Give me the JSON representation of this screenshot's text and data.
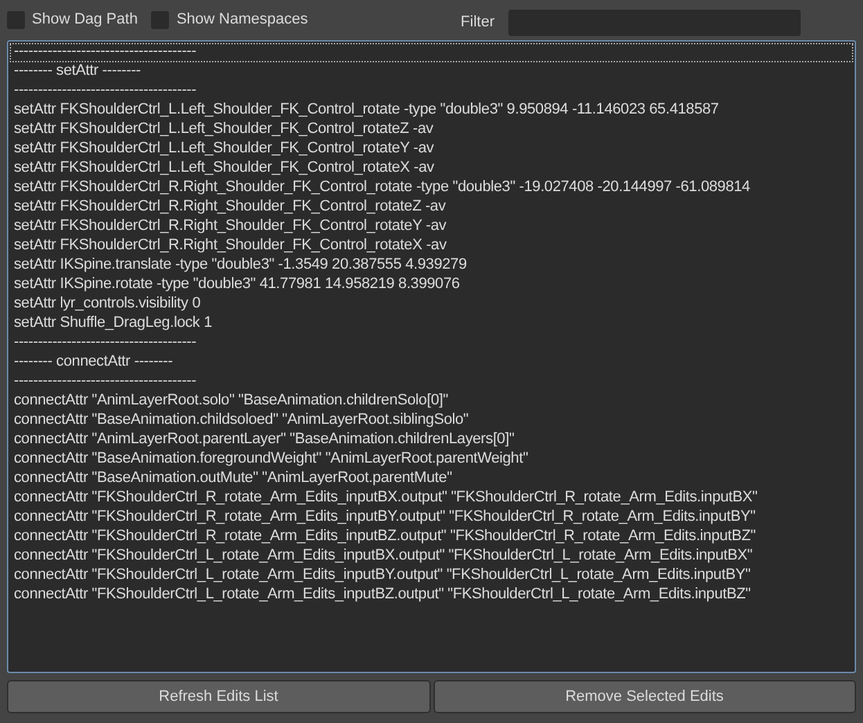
{
  "options": [
    {
      "label": "Show Dag Path",
      "checked": false
    },
    {
      "label": "Show Namespaces",
      "checked": false
    }
  ],
  "filter": {
    "label": "Filter"
  },
  "edits": [
    {
      "text": "--------------------------------------",
      "focused": true
    },
    {
      "text": "-------- setAttr --------",
      "focused": false
    },
    {
      "text": "--------------------------------------",
      "focused": false
    },
    {
      "text": "setAttr FKShoulderCtrl_L.Left_Shoulder_FK_Control_rotate -type \"double3\" 9.950894 -11.146023 65.418587",
      "focused": false
    },
    {
      "text": "setAttr FKShoulderCtrl_L.Left_Shoulder_FK_Control_rotateZ -av",
      "focused": false
    },
    {
      "text": "setAttr FKShoulderCtrl_L.Left_Shoulder_FK_Control_rotateY -av",
      "focused": false
    },
    {
      "text": "setAttr FKShoulderCtrl_L.Left_Shoulder_FK_Control_rotateX -av",
      "focused": false
    },
    {
      "text": "setAttr FKShoulderCtrl_R.Right_Shoulder_FK_Control_rotate -type \"double3\" -19.027408 -20.144997 -61.089814",
      "focused": false
    },
    {
      "text": "setAttr FKShoulderCtrl_R.Right_Shoulder_FK_Control_rotateZ -av",
      "focused": false
    },
    {
      "text": "setAttr FKShoulderCtrl_R.Right_Shoulder_FK_Control_rotateY -av",
      "focused": false
    },
    {
      "text": "setAttr FKShoulderCtrl_R.Right_Shoulder_FK_Control_rotateX -av",
      "focused": false
    },
    {
      "text": "setAttr IKSpine.translate -type \"double3\" -1.3549 20.387555 4.939279",
      "focused": false
    },
    {
      "text": "setAttr IKSpine.rotate -type \"double3\" 41.77981 14.958219 8.399076",
      "focused": false
    },
    {
      "text": "setAttr lyr_controls.visibility 0",
      "focused": false
    },
    {
      "text": "setAttr Shuffle_DragLeg.lock 1",
      "focused": false
    },
    {
      "text": "--------------------------------------",
      "focused": false
    },
    {
      "text": "-------- connectAttr --------",
      "focused": false
    },
    {
      "text": "--------------------------------------",
      "focused": false
    },
    {
      "text": "connectAttr \"AnimLayerRoot.solo\" \"BaseAnimation.childrenSolo[0]\"",
      "focused": false
    },
    {
      "text": "connectAttr \"BaseAnimation.childsoloed\" \"AnimLayerRoot.siblingSolo\"",
      "focused": false
    },
    {
      "text": "connectAttr \"AnimLayerRoot.parentLayer\" \"BaseAnimation.childrenLayers[0]\"",
      "focused": false
    },
    {
      "text": "connectAttr \"BaseAnimation.foregroundWeight\" \"AnimLayerRoot.parentWeight\"",
      "focused": false
    },
    {
      "text": "connectAttr \"BaseAnimation.outMute\" \"AnimLayerRoot.parentMute\"",
      "focused": false
    },
    {
      "text": "connectAttr \"FKShoulderCtrl_R_rotate_Arm_Edits_inputBX.output\" \"FKShoulderCtrl_R_rotate_Arm_Edits.inputBX\"",
      "focused": false
    },
    {
      "text": "connectAttr \"FKShoulderCtrl_R_rotate_Arm_Edits_inputBY.output\" \"FKShoulderCtrl_R_rotate_Arm_Edits.inputBY\"",
      "focused": false
    },
    {
      "text": "connectAttr \"FKShoulderCtrl_R_rotate_Arm_Edits_inputBZ.output\" \"FKShoulderCtrl_R_rotate_Arm_Edits.inputBZ\"",
      "focused": false
    },
    {
      "text": "connectAttr \"FKShoulderCtrl_L_rotate_Arm_Edits_inputBX.output\" \"FKShoulderCtrl_L_rotate_Arm_Edits.inputBX\"",
      "focused": false
    },
    {
      "text": "connectAttr \"FKShoulderCtrl_L_rotate_Arm_Edits_inputBY.output\" \"FKShoulderCtrl_L_rotate_Arm_Edits.inputBY\"",
      "focused": false
    },
    {
      "text": "connectAttr \"FKShoulderCtrl_L_rotate_Arm_Edits_inputBZ.output\" \"FKShoulderCtrl_L_rotate_Arm_Edits.inputBZ\"",
      "focused": false
    }
  ],
  "buttons": [
    "Refresh Edits List",
    "Remove Selected Edits"
  ]
}
